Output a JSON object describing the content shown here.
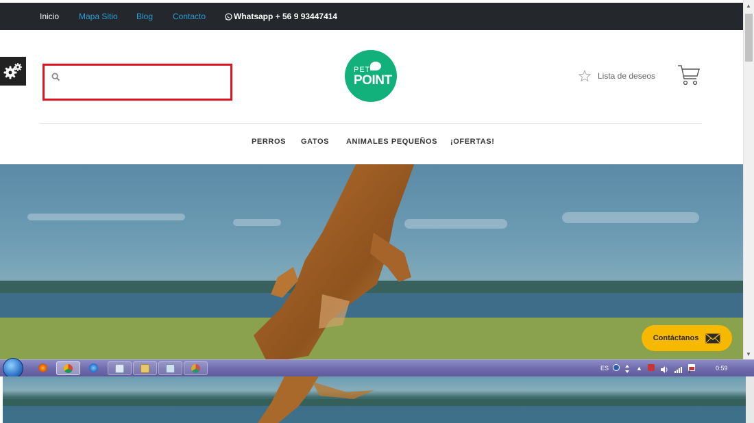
{
  "topbar": {
    "links": [
      {
        "label": "Inicio",
        "color": "#ffffff"
      },
      {
        "label": "Mapa Sitio",
        "color": "#2a9fd6"
      },
      {
        "label": "Blog",
        "color": "#2a9fd6"
      },
      {
        "label": "Contacto",
        "color": "#2a9fd6"
      }
    ],
    "whatsapp": "Whatsapp + 56 9 93447414"
  },
  "header": {
    "search_placeholder": "",
    "logo": {
      "line1": "PET",
      "line2": "POINT",
      "color": "#12b07a"
    },
    "wishlist_label": "Lista de deseos"
  },
  "nav": {
    "items": [
      "PERROS",
      "GATOS",
      "ANIMALES PEQUEÑOS",
      "¡OFERTAS!"
    ]
  },
  "contact_button": {
    "label": "Contáctanos",
    "color": "#f7b900"
  },
  "taskbar": {
    "language": "ES",
    "clock": "0:59"
  },
  "colors": {
    "topbar_bg": "#24272c",
    "highlight": "#e0141e"
  },
  "icons": {
    "settings": "gears-icon",
    "search": "search-icon",
    "wishlist": "star-icon",
    "cart": "cart-icon",
    "mail": "envelope-icon",
    "whatsapp": "whatsapp-icon"
  }
}
